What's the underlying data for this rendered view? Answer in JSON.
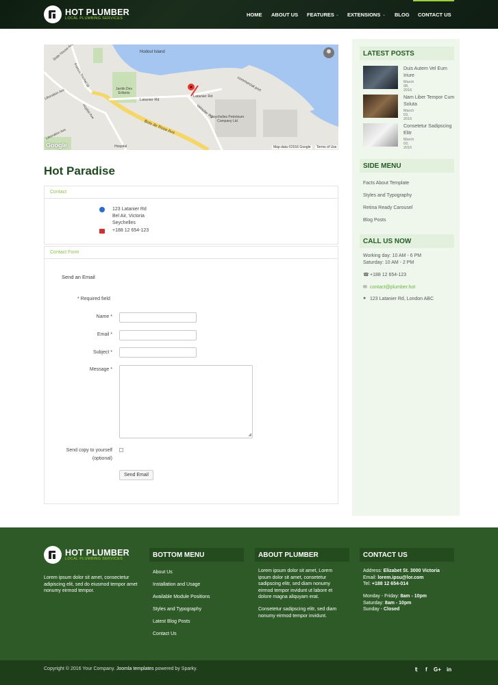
{
  "header": {
    "brand": "HOT PLUMBER",
    "tagline": "LOCAL PLUMBING SERVICES",
    "nav": [
      "HOME",
      "ABOUT US",
      "FEATURES",
      "EXTENSIONS",
      "BLOG",
      "CONTACT US"
    ],
    "accent_color": "#9bd13a"
  },
  "map": {
    "labels": {
      "island": "Hodoul Island",
      "street1": "Latanier Rd",
      "street2": "Latanier Rd",
      "street3": "Velouter Rd",
      "road": "Bois de Rose Ave",
      "port": "commercial port",
      "company": "Seychelles Petroleum Company Ltd",
      "garden": "Jardin Des Enfants",
      "hospital": "Hospital",
      "avenue1": "Liberation Ave",
      "avenue2": "Francis Rachel St",
      "avenue3": "Hopital Ave",
      "house": "State House Ave",
      "liberation2": "Liberation Ave"
    },
    "google": "Google",
    "attribution": "Map data ©2016 Google",
    "terms": "Terms of Use"
  },
  "page_title": "Hot Paradise",
  "contact": {
    "heading": "Contact",
    "address_line1": "123 Latanier Rd",
    "address_line2": "Bel Air, Victoria",
    "address_line3": "Seychelles",
    "phone": "+188 12 654-123"
  },
  "form": {
    "heading": "Contact Form",
    "send_title": "Send an Email",
    "required_note": "* Required field",
    "name_label": "Name *",
    "email_label": "Email *",
    "subject_label": "Subject *",
    "message_label": "Message *",
    "copy_label": "Send copy to yourself",
    "copy_optional": "(optional)",
    "submit": "Send Email"
  },
  "sidebar": {
    "latest_heading": "LATEST POSTS",
    "posts": [
      {
        "title": "Duis Autem Vel Eum Iriure",
        "date": "March 08, 2016"
      },
      {
        "title": "Nam Liber Tempor Cum Soluta",
        "date": "March 03, 2016"
      },
      {
        "title": "Consetetur Sadipscing Elitr",
        "date": "March 03, 2016"
      }
    ],
    "menu_heading": "SIDE MENU",
    "menu": [
      "Facts About Template",
      "Styles and Typography",
      "Retina Ready Carousel",
      "Blog Posts"
    ],
    "call_heading": "CALL US NOW",
    "hours1": "Working day: 10 AM - 6 PM",
    "hours2": "Saturday: 10 AM - 2 PM",
    "phone": "+188 12 654-123",
    "email": "contact@plumber.hot",
    "address": "123 Latanier Rd, London ABC"
  },
  "footer": {
    "brand": "HOT PLUMBER",
    "tagline": "LOCAL PLUMBING SERVICES",
    "about": "Lorem ipsum dolor sit amet, consectetur adipiscing elit, sed do eiusmod tempor amet nonumy eirmod tempor.",
    "bottom_menu_heading": "BOTTOM MENU",
    "bottom_menu": [
      "About Us",
      "Installation and Usage",
      "Available Module Positions",
      "Styles and Typography",
      "Latest Blog Posts",
      "Contact Us"
    ],
    "about_heading": "ABOUT PLUMBER",
    "about_p1": "Lorem ipsum dolor sit amet, Lorem ipsum dolor sit amet, consetetur sadipscing elitr, sed diam nonumy eirmod tempor invidunt ut labore et dolore magna aliquyam erat.",
    "about_p2": "Consetetur sadipscing elitr, sed diam nonumy eirmod tempor invidunt.",
    "contact_heading": "CONTACT US",
    "address_label": "Address:",
    "address": "Elizabet St. 3000 Victoria",
    "email_label": "Email:",
    "email": "lorem.ipsu@lor.com",
    "tel_label": "Tel:",
    "tel": "+188 12 654-014",
    "mf_label": "Monday - Friday:",
    "mf": "8am - 10pm",
    "sat_label": "Saturday:",
    "sat": "8am - 10pm",
    "sun_label": "Sunday -",
    "sun": "Closed"
  },
  "bottom_bar": {
    "copy_prefix": "Copyright © 2016 Your Company.",
    "copy_link": "Joomla templates",
    "copy_suffix": "powered by Sparky.",
    "social": [
      "twitter-icon",
      "facebook-icon",
      "google-plus-icon",
      "linkedin-icon"
    ]
  }
}
